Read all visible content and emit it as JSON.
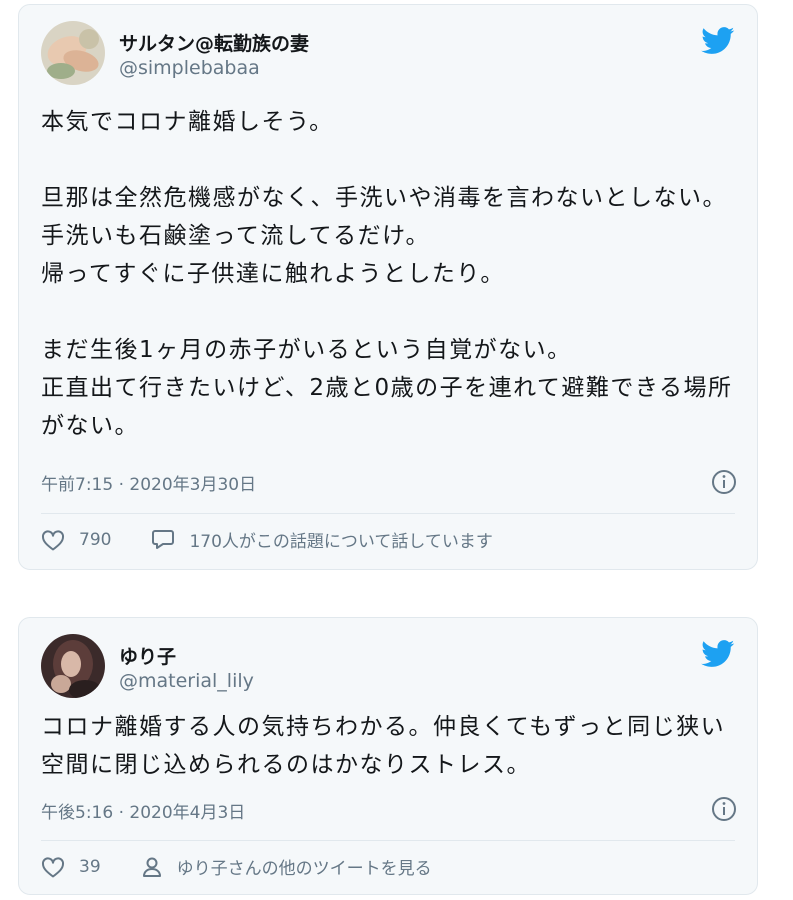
{
  "tweets": [
    {
      "display_name": "サルタン@転勤族の妻",
      "handle": "@simplebabaa",
      "avatar_icon": "avatar-photo-hands",
      "paragraphs": [
        "本気でコロナ離婚しそう。",
        "旦那は全然危機感がなく、手洗いや消毒を言わないとしない。\n手洗いも石鹸塗って流してるだけ。\n帰ってすぐに子供達に触れようとしたり。",
        "まだ生後1ヶ月の赤子がいるという自覚がない。\n正直出て行きたいけど、2歳と0歳の子を連れて避難できる場所がない。"
      ],
      "timestamp": "午前7:15 · 2020年3月30日",
      "likes": "790",
      "like_icon": "heart-icon",
      "secondary_icon": "speech-bubble-icon",
      "secondary_text": "170人がこの話題について話しています"
    },
    {
      "display_name": "ゆり子",
      "handle": "@material_lily",
      "avatar_icon": "avatar-photo-woman",
      "paragraphs": [
        "コロナ離婚する人の気持ちわかる。仲良くてもずっと同じ狭い空間に閉じ込められるのはかなりストレス。"
      ],
      "timestamp": "午後5:16 · 2020年4月3日",
      "likes": "39",
      "like_icon": "heart-icon",
      "secondary_icon": "person-icon",
      "secondary_text": "ゆり子さんの他のツイートを見る"
    }
  ],
  "colors": {
    "card_bg": "#f5f8fa",
    "border": "#e1e8ed",
    "text_primary": "#14171a",
    "text_secondary": "#657786",
    "twitter_blue": "#1da1f2"
  }
}
